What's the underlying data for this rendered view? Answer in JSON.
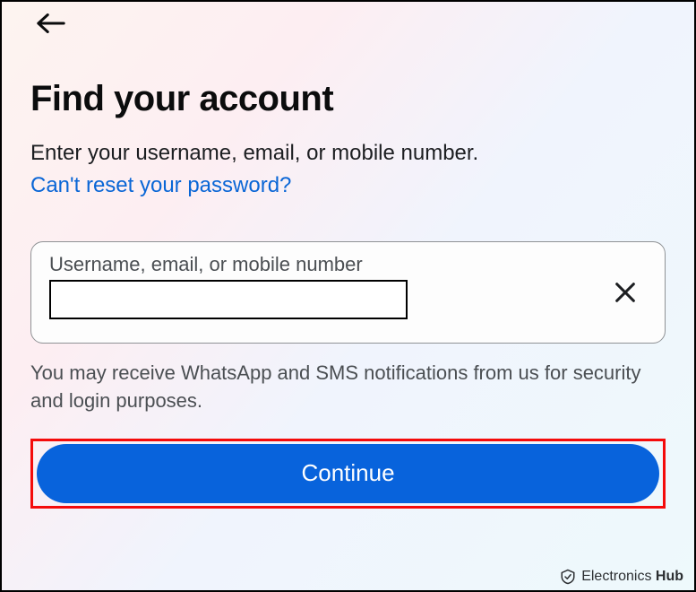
{
  "header": {
    "back_icon": "back"
  },
  "page": {
    "title": "Find your account",
    "subtitle": "Enter your username, email, or mobile number.",
    "reset_link": "Can't reset your password?"
  },
  "form": {
    "input_label": "Username, email, or mobile number",
    "input_value": "",
    "clear_icon": "close"
  },
  "notice": "You may receive WhatsApp and SMS notifications from us for security and login purposes.",
  "actions": {
    "continue_label": "Continue"
  },
  "watermark": {
    "brand_name": "Electronics",
    "brand_suffix": "Hub"
  }
}
